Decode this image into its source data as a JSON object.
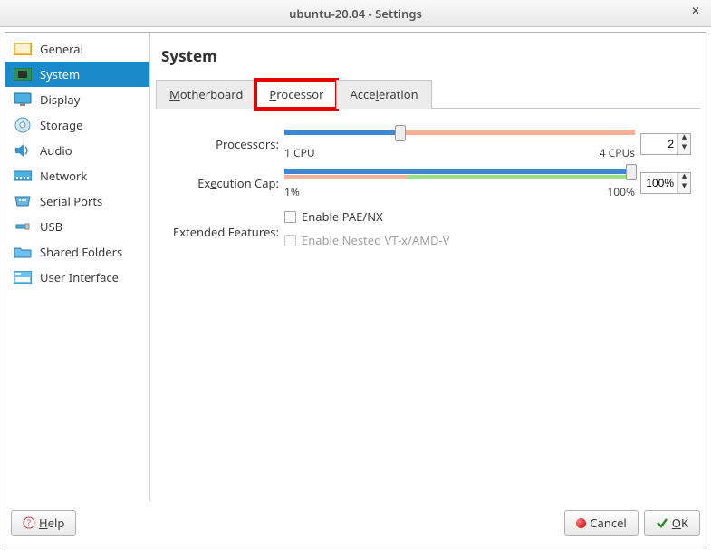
{
  "window": {
    "title": "ubuntu-20.04 - Settings"
  },
  "sidebar": {
    "items": [
      {
        "label": "General"
      },
      {
        "label": "System"
      },
      {
        "label": "Display"
      },
      {
        "label": "Storage"
      },
      {
        "label": "Audio"
      },
      {
        "label": "Network"
      },
      {
        "label": "Serial Ports"
      },
      {
        "label": "USB"
      },
      {
        "label": "Shared Folders"
      },
      {
        "label": "User Interface"
      }
    ],
    "selected_index": 1
  },
  "page": {
    "title": "System"
  },
  "tabs": {
    "items": [
      {
        "pre": "",
        "u": "M",
        "post": "otherboard"
      },
      {
        "pre": "",
        "u": "P",
        "post": "rocessor"
      },
      {
        "pre": "Acce",
        "u": "l",
        "post": "eration"
      }
    ],
    "active_index": 1
  },
  "processors": {
    "label_pre": "Process",
    "label_u": "o",
    "label_post": "rs:",
    "min_label": "1 CPU",
    "max_label": "4 CPUs",
    "value": "2",
    "slider_percent": 33
  },
  "exec_cap": {
    "label_pre": "Ex",
    "label_u": "e",
    "label_post": "cution Cap:",
    "min_label": "1%",
    "max_label": "100%",
    "value": "100%",
    "slider_percent": 100
  },
  "extended": {
    "label": "Extended Features:",
    "pae_label": "Enable PAE/NX",
    "pae_checked": false,
    "nested_pre": "Enable Nested ",
    "nested_u": "V",
    "nested_post": "T-x/AMD-V",
    "nested_enabled": false
  },
  "footer": {
    "help": "Help",
    "cancel": "Cancel",
    "ok": "OK"
  }
}
